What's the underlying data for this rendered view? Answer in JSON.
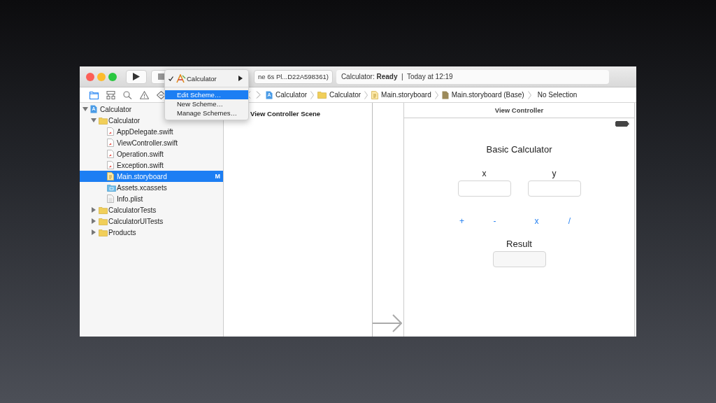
{
  "toolbar": {
    "scheme_button": "ne 6s Pl...D22A598361)",
    "status": "Calculator: **Ready**  |  Today at 12:19"
  },
  "scheme_menu": {
    "items": [
      {
        "kind": "scheme",
        "label": "Calculator",
        "checked": true,
        "selected": false
      },
      {
        "kind": "action",
        "label": "Edit Scheme…",
        "checked": false,
        "selected": true
      },
      {
        "kind": "action",
        "label": "New Scheme…",
        "checked": false,
        "selected": false
      },
      {
        "kind": "action",
        "label": "Manage Schemes…",
        "checked": false,
        "selected": false
      }
    ]
  },
  "navigator_tabs": [
    {
      "kind": "folder",
      "selected": true
    },
    {
      "kind": "hierarchy",
      "selected": false
    },
    {
      "kind": "search",
      "selected": false
    },
    {
      "kind": "warning",
      "selected": false
    },
    {
      "kind": "test",
      "selected": false
    }
  ],
  "jump_bar": [
    {
      "kind": "project",
      "label": "Calculator"
    },
    {
      "kind": "folder",
      "label": "Calculator"
    },
    {
      "kind": "storyboard",
      "label": "Main.storyboard"
    },
    {
      "kind": "base",
      "label": "Main.storyboard (Base)"
    },
    {
      "kind": "none",
      "label": "No Selection"
    }
  ],
  "navigator": {
    "items": [
      {
        "kind": "project",
        "label": "Calculator",
        "expanded": true,
        "selected": false,
        "children": [
          {
            "kind": "folder",
            "label": "Calculator",
            "expanded": true,
            "selected": false,
            "children": [
              {
                "kind": "swift",
                "label": "AppDelegate.swift",
                "selected": false
              },
              {
                "kind": "swift",
                "label": "ViewController.swift",
                "selected": false
              },
              {
                "kind": "swift",
                "label": "Operation.swift",
                "selected": false
              },
              {
                "kind": "swift",
                "label": "Exception.swift",
                "selected": false
              },
              {
                "kind": "storyboard",
                "label": "Main.storyboard",
                "selected": true,
                "badge": "M"
              },
              {
                "kind": "assets",
                "label": "Assets.xcassets",
                "selected": false
              },
              {
                "kind": "plist",
                "label": "Info.plist",
                "selected": false
              }
            ]
          },
          {
            "kind": "folder",
            "label": "CalculatorTests",
            "expanded": false,
            "selected": false
          },
          {
            "kind": "folder",
            "label": "CalculatorUITests",
            "expanded": false,
            "selected": false
          },
          {
            "kind": "folder",
            "label": "Products",
            "expanded": false,
            "selected": false
          }
        ]
      }
    ]
  },
  "outline": {
    "title": "View Controller Scene"
  },
  "scene": {
    "header": "View Controller",
    "title": "Basic Calculator",
    "inputs": [
      {
        "label": "x"
      },
      {
        "label": "y"
      }
    ],
    "operations": [
      "+",
      "-",
      "x",
      "/"
    ],
    "result_label": "Result"
  }
}
